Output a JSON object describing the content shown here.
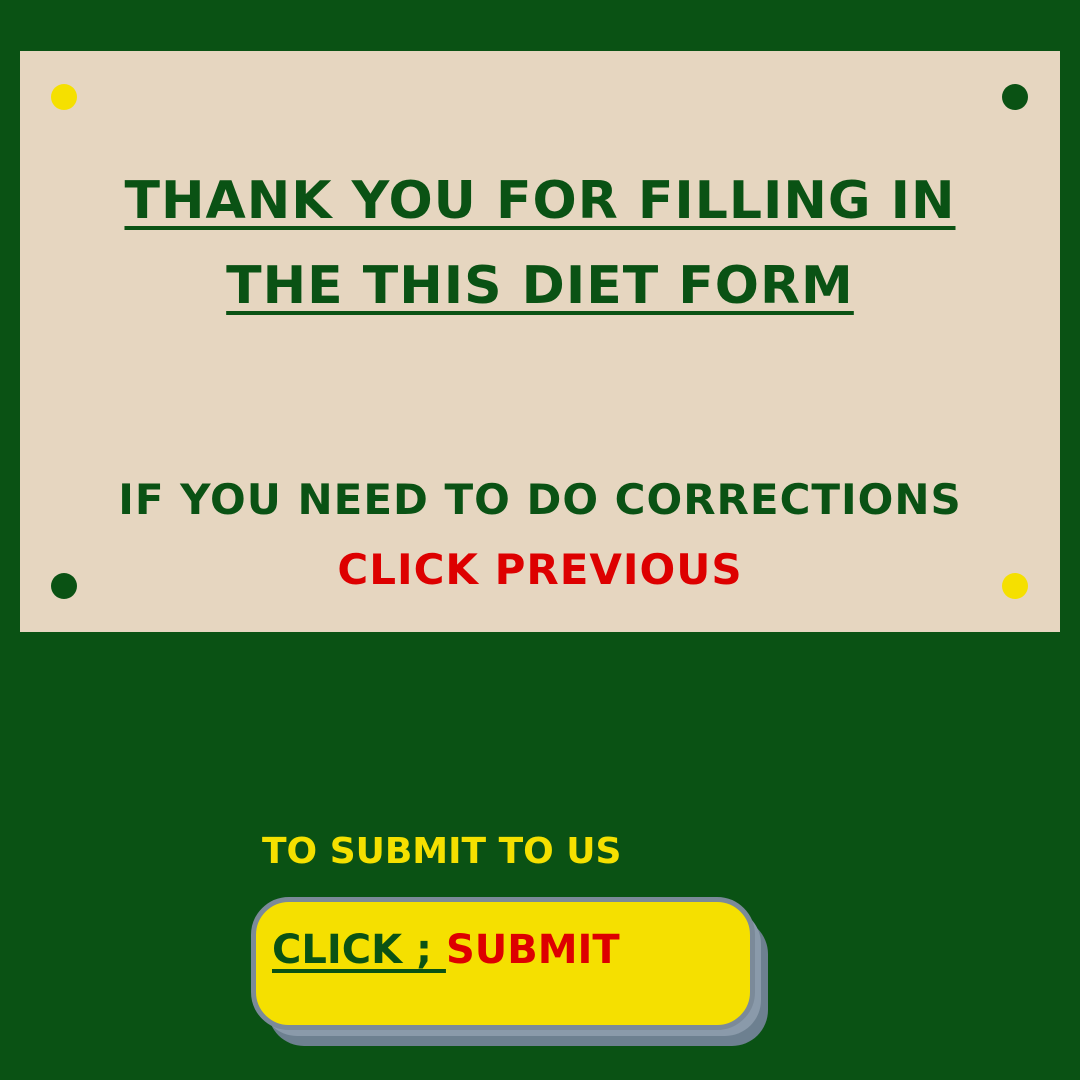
{
  "colors": {
    "background": "#0a5214",
    "panel": "#e6d6c0",
    "green_text": "#0a5214",
    "red_text": "#dd0000",
    "yellow": "#f5e000",
    "dark_green_dot": "#0a5214"
  },
  "panel": {
    "title_line1": "THANK YOU FOR FILLING IN",
    "title_line2": "THE THIS DIET FORM",
    "corrections_text": "IF YOU NEED TO DO CORRECTIONS",
    "click_previous": "CLICK PREVIOUS"
  },
  "submit": {
    "caption": "TO SUBMIT TO US",
    "button_click_label": "CLICK ; ",
    "button_submit_label": "SUBMIT"
  }
}
